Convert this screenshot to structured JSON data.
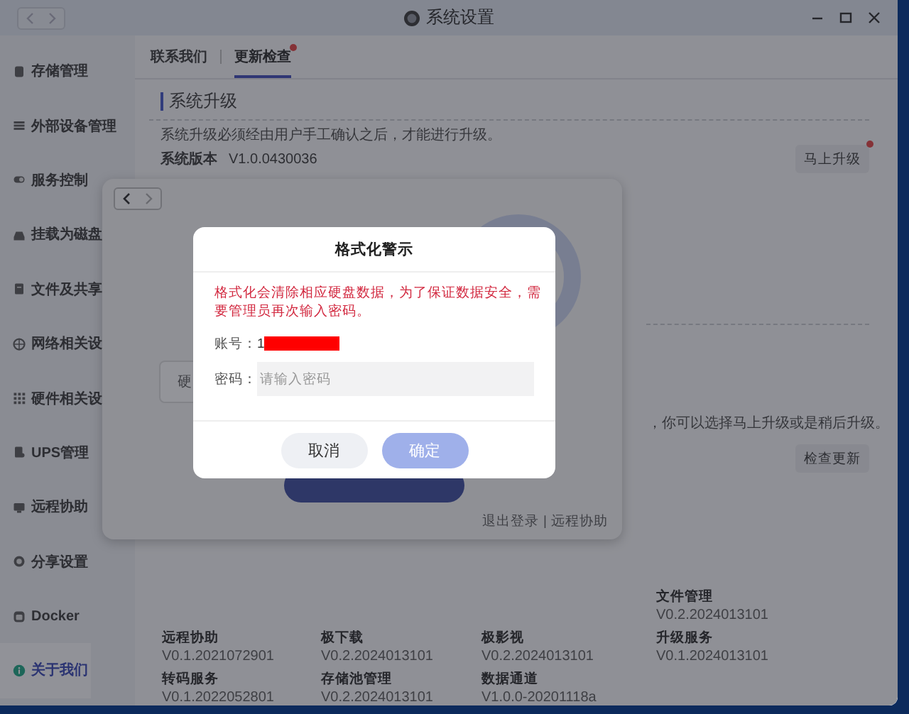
{
  "window": {
    "title": "系统设置"
  },
  "sidebar": {
    "items": [
      {
        "label": "存储管理",
        "selected": false
      },
      {
        "label": "外部设备管理",
        "selected": false
      },
      {
        "label": "服务控制",
        "selected": false
      },
      {
        "label": "挂载为磁盘",
        "selected": false
      },
      {
        "label": "文件及共享",
        "selected": false
      },
      {
        "label": "网络相关设",
        "selected": false
      },
      {
        "label": "硬件相关设",
        "selected": false
      },
      {
        "label": "UPS管理",
        "selected": false
      },
      {
        "label": "远程协助",
        "selected": false
      },
      {
        "label": "分享设置",
        "selected": false
      },
      {
        "label": "Docker",
        "selected": false
      },
      {
        "label": "关于我们",
        "selected": true
      }
    ]
  },
  "tabs": [
    {
      "label": "联系我们",
      "selected": false,
      "dot": false
    },
    {
      "label": "更新检查",
      "selected": true,
      "dot": true
    }
  ],
  "upgrade": {
    "heading": "系统升级",
    "description": "系统升级必须经由用户手工确认之后，才能进行升级。",
    "version_label": "系统版本",
    "version": "V1.0.0430036",
    "upgrade_button": {
      "label": "马上升级",
      "dot": true
    },
    "note": "，你可以选择马上升级或是稍后升级。",
    "check_button": "检查更新"
  },
  "apps": [
    {
      "name": "文件管理",
      "version": "V0.2.2024013101"
    },
    {
      "name": "远程协助",
      "version": "V0.1.2021072901"
    },
    {
      "name": "极下载",
      "version": "V0.2.2024013101"
    },
    {
      "name": "极影视",
      "version": "V0.2.2024013101"
    },
    {
      "name": "升级服务",
      "version": "V0.1.2024013101"
    },
    {
      "name": "转码服务",
      "version": "V0.1.2022052801"
    },
    {
      "name": "存储池管理",
      "version": "V0.2.2024013101"
    },
    {
      "name": "数据通道",
      "version": "V1.0.0-20201118a"
    }
  ],
  "panel": {
    "field_label": "硬",
    "links": [
      "退出登录",
      "远程协助"
    ],
    "separator": "|"
  },
  "dialog": {
    "title": "格式化警示",
    "warning": "格式化会清除相应硬盘数据，为了保证数据安全，需要管理员再次输入密码。",
    "account_label": "账号：",
    "account_value": "1",
    "password_label": "密码：",
    "password_placeholder": "请输入密码",
    "buttons": [
      {
        "label": "取消",
        "kind": "secondary",
        "disabled": false
      },
      {
        "label": "确定",
        "kind": "primary",
        "disabled": true
      }
    ]
  }
}
